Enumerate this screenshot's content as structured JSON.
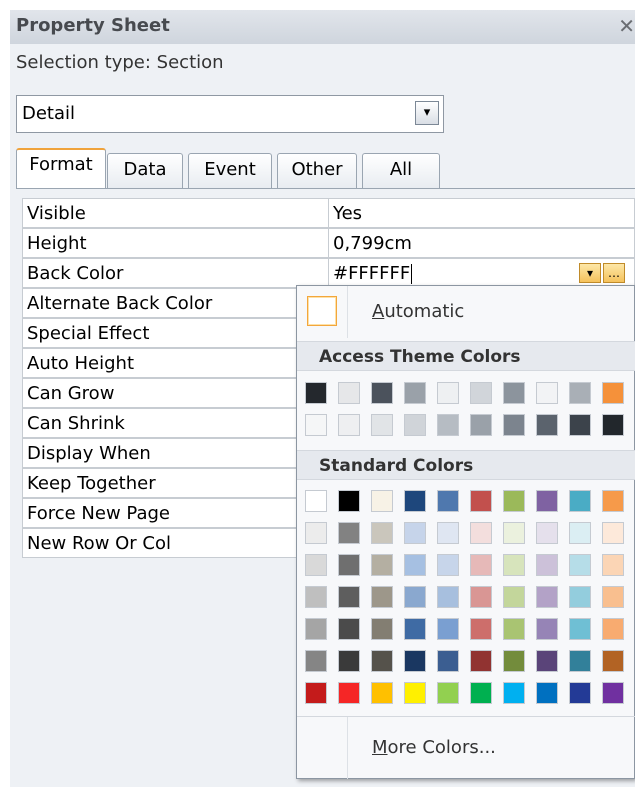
{
  "panel": {
    "title": "Property Sheet",
    "close_glyph": "✕",
    "selection_type": "Selection type:  Section",
    "selector": {
      "value": "Detail",
      "dropdown_glyph": "▾"
    }
  },
  "tabs": [
    {
      "label": "Format",
      "active": true
    },
    {
      "label": "Data",
      "active": false
    },
    {
      "label": "Event",
      "active": false
    },
    {
      "label": "Other",
      "active": false
    },
    {
      "label": "All",
      "active": false
    }
  ],
  "properties": [
    {
      "name": "Visible",
      "value": "Yes"
    },
    {
      "name": "Height",
      "value": "0,799cm"
    },
    {
      "name": "Back Color",
      "value": "#FFFFFF"
    },
    {
      "name": "Alternate Back Color",
      "value": ""
    },
    {
      "name": "Special Effect",
      "value": ""
    },
    {
      "name": "Auto Height",
      "value": ""
    },
    {
      "name": "Can Grow",
      "value": ""
    },
    {
      "name": "Can Shrink",
      "value": ""
    },
    {
      "name": "Display When",
      "value": ""
    },
    {
      "name": "Keep Together",
      "value": ""
    },
    {
      "name": "Force New Page",
      "value": ""
    },
    {
      "name": "New Row Or Col",
      "value": ""
    }
  ],
  "back_color_buttons": {
    "dropdown_glyph": "▾",
    "builder_glyph": "…"
  },
  "color_picker": {
    "automatic_label_first": "A",
    "automatic_label_rest": "utomatic",
    "theme_heading": "Access Theme Colors",
    "standard_heading": "Standard Colors",
    "more_label_first": "M",
    "more_label_rest": "ore Colors...",
    "theme_colors": [
      [
        "#24282d",
        "#e6e7e9",
        "#4b525c",
        "#9aa1a9",
        "#eef0f2",
        "#d1d5da",
        "#8c949d",
        "#f2f3f5",
        "#a9afb6",
        "#f5913a"
      ],
      [
        "#f5f6f7",
        "#eeeff1",
        "#e1e4e7",
        "#d0d4d9",
        "#b6bcc3",
        "#9aa1a9",
        "#7c848e",
        "#5b636d",
        "#3c434b",
        "#22272c"
      ]
    ],
    "standard_colors": [
      [
        "#ffffff",
        "#000000",
        "#f7f2e6",
        "#1e477c",
        "#4f78ae",
        "#c2504d",
        "#9bb95a",
        "#7f62a2",
        "#4aacc5",
        "#f69a4a"
      ],
      [
        "#ececec",
        "#828282",
        "#cac6bc",
        "#c6d4ea",
        "#dfe6f2",
        "#f3dedd",
        "#ebf1de",
        "#e5e0ec",
        "#dbeef3",
        "#fde9da"
      ],
      [
        "#d9d9d9",
        "#6f6f6f",
        "#b4afa2",
        "#a6c0e2",
        "#c7d5ea",
        "#e6b9b8",
        "#d7e4bc",
        "#ccc1d9",
        "#b6dde8",
        "#fbd5b5"
      ],
      [
        "#bfbfbf",
        "#5e5e5e",
        "#9d978a",
        "#8aa8cf",
        "#a7bfde",
        "#d99694",
        "#c3d69b",
        "#b3a2c7",
        "#93cddd",
        "#f9bf8f"
      ],
      [
        "#a5a5a5",
        "#4b4b4b",
        "#837e72",
        "#3f6ba4",
        "#7a9fd1",
        "#cd6e6b",
        "#a9c472",
        "#9684b6",
        "#6fbfd4",
        "#f8ab70"
      ],
      [
        "#858585",
        "#3a3a3a",
        "#55524b",
        "#1a3761",
        "#3b5e91",
        "#913331",
        "#738c3c",
        "#5a4479",
        "#32809a",
        "#b26324"
      ],
      [
        "#c41b1b",
        "#f52626",
        "#ffc000",
        "#fff000",
        "#92d050",
        "#00b050",
        "#00b0f0",
        "#0070c0",
        "#233a96",
        "#7030a0"
      ]
    ]
  }
}
